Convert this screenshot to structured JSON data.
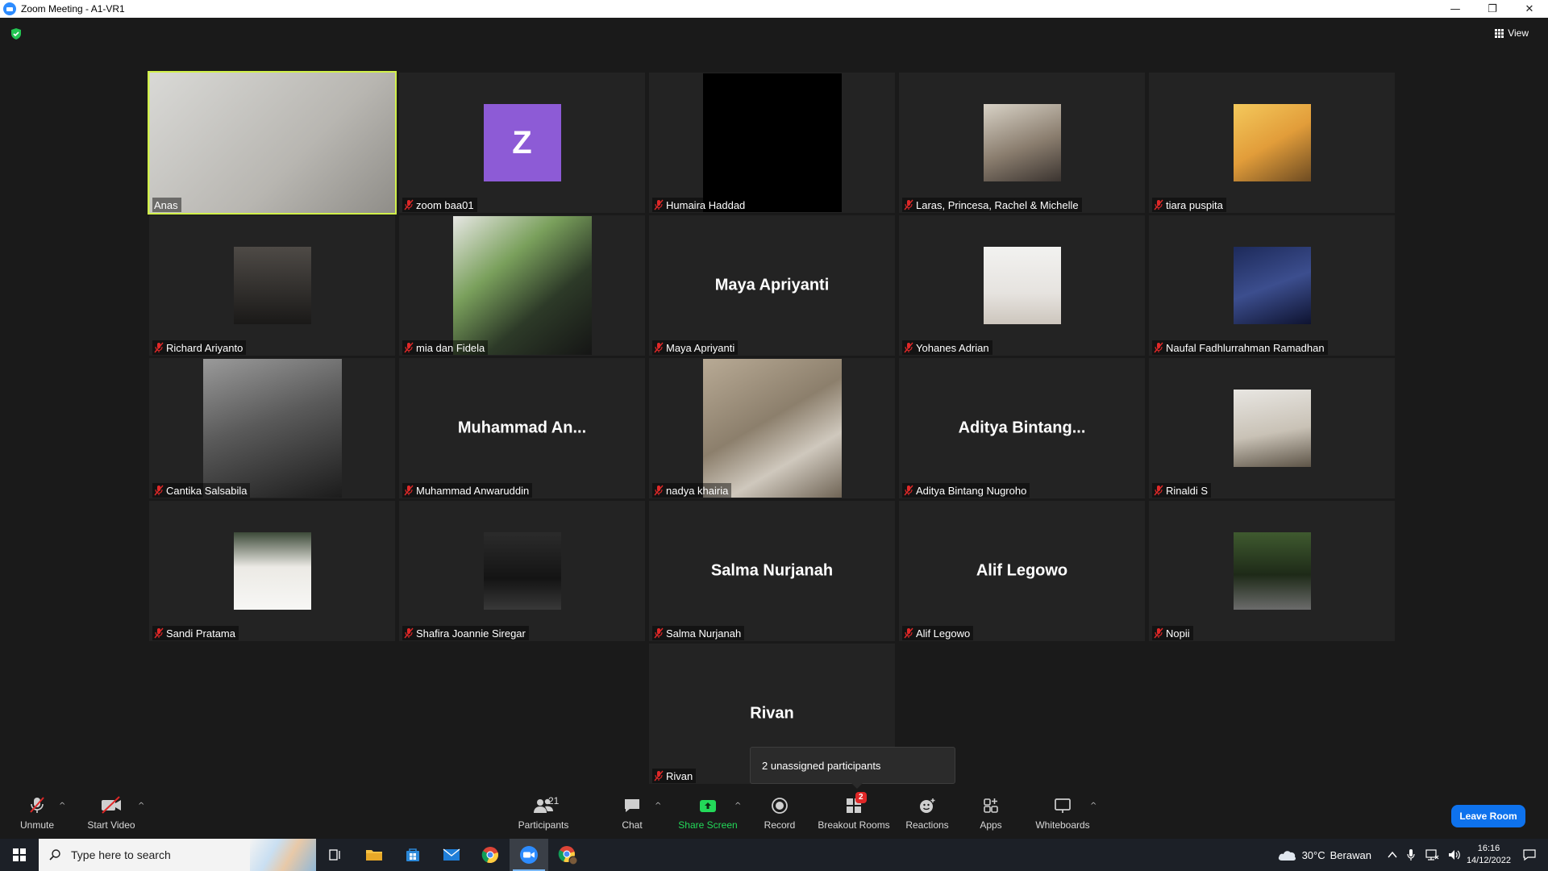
{
  "window": {
    "title": "Zoom Meeting - A1-VR1",
    "minimize_glyph": "—",
    "restore_glyph": "❐",
    "close_glyph": "✕"
  },
  "meeting": {
    "view_label": "View",
    "security_icon": "green-shield-icon",
    "tiles": [
      {
        "name": "Anas",
        "kind": "video",
        "active": true,
        "muted": false
      },
      {
        "name": "zoom baa01",
        "kind": "avatar",
        "initial": "Z",
        "avatar_color": "#8d5bd6",
        "muted": true
      },
      {
        "name": "Humaira Haddad",
        "kind": "video-black",
        "muted": true
      },
      {
        "name": "Laras, Princesa, Rachel & Michelle",
        "kind": "photo",
        "muted": true
      },
      {
        "name": "tiara puspita",
        "kind": "photo",
        "muted": true
      },
      {
        "name": "Richard Ariyanto",
        "kind": "photo",
        "muted": true
      },
      {
        "name": "mia dan Fidela",
        "kind": "video",
        "muted": true
      },
      {
        "name": "Maya Apriyanti",
        "kind": "name",
        "display_name": "Maya Apriyanti",
        "muted": true
      },
      {
        "name": "Yohanes Adrian",
        "kind": "photo",
        "muted": true
      },
      {
        "name": "Naufal Fadhlurrahman Ramadhan",
        "kind": "photo",
        "muted": true
      },
      {
        "name": "Cantika Salsabila",
        "kind": "video",
        "muted": true
      },
      {
        "name": "Muhammad Anwaruddin",
        "kind": "name",
        "display_name": "Muhammad  An...",
        "muted": true
      },
      {
        "name": "nadya khairia",
        "kind": "video",
        "muted": true
      },
      {
        "name": "Aditya Bintang Nugroho",
        "kind": "name",
        "display_name": "Aditya  Bintang...",
        "muted": true
      },
      {
        "name": "Rinaldi S",
        "kind": "photo",
        "muted": true
      },
      {
        "name": "Sandi Pratama",
        "kind": "photo",
        "muted": true
      },
      {
        "name": "Shafira Joannie Siregar",
        "kind": "photo",
        "muted": true
      },
      {
        "name": "Salma Nurjanah",
        "kind": "name",
        "display_name": "Salma Nurjanah",
        "muted": true
      },
      {
        "name": "Alif Legowo",
        "kind": "name",
        "display_name": "Alif Legowo",
        "muted": true
      },
      {
        "name": "Nopii",
        "kind": "photo",
        "muted": true
      },
      {
        "name": "Rivan",
        "kind": "name",
        "display_name": "Rivan",
        "muted": true
      }
    ],
    "tooltip": "2 unassigned participants"
  },
  "toolbar": {
    "unmute": "Unmute",
    "start_video": "Start Video",
    "participants": "Participants",
    "participants_count": "21",
    "chat": "Chat",
    "share_screen": "Share Screen",
    "record": "Record",
    "breakout_rooms": "Breakout Rooms",
    "breakout_badge": "2",
    "reactions": "Reactions",
    "apps": "Apps",
    "whiteboards": "Whiteboards",
    "leave_room": "Leave Room"
  },
  "taskbar": {
    "search_placeholder": "Type here to search",
    "weather_temp": "30°C",
    "weather_desc": "Berawan",
    "time": "16:16",
    "date": "14/12/2022"
  },
  "colors": {
    "active_speaker": "#d1f04a",
    "leave_button": "#0e72ed",
    "share_screen": "#23d959",
    "muted_icon": "#e02828"
  }
}
